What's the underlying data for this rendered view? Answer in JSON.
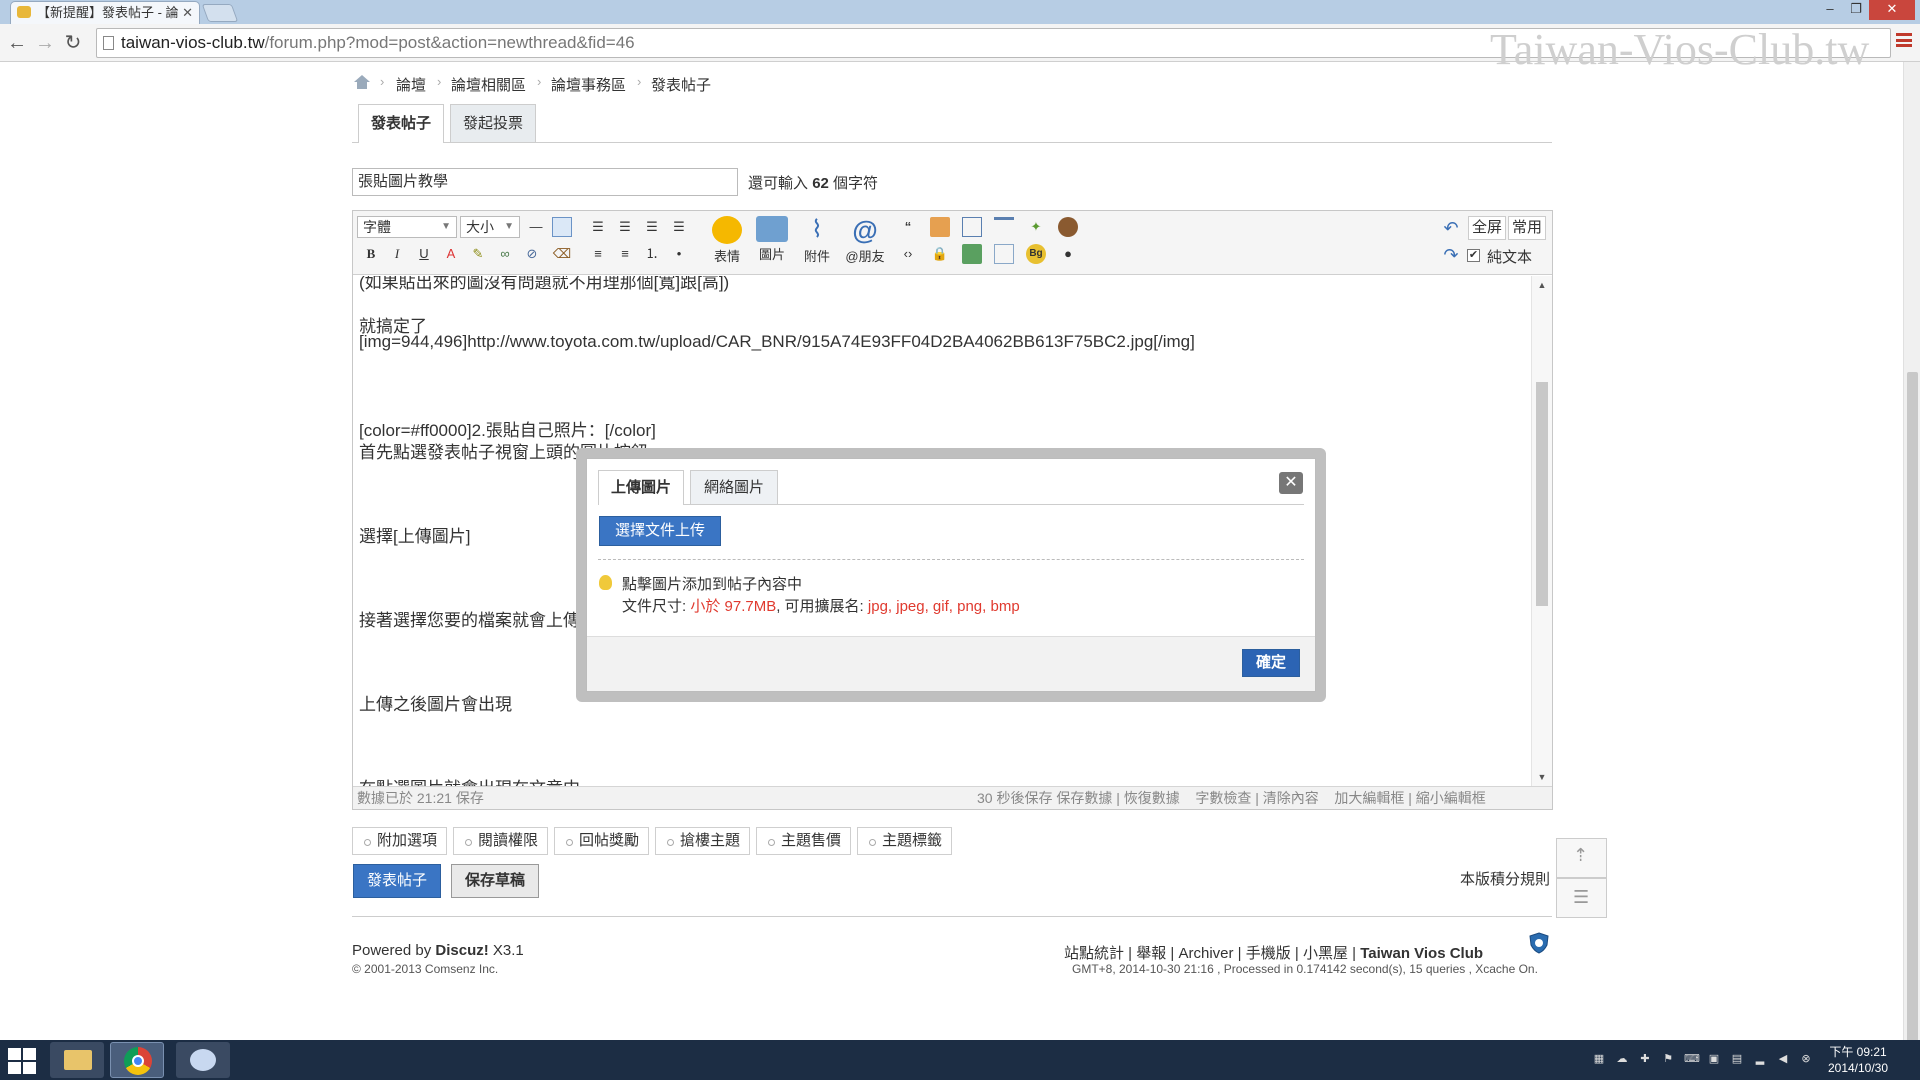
{
  "browser": {
    "tab_title": "【新提醒】發表帖子 - 論",
    "url_host": "taiwan-vios-club.tw",
    "url_path": "/forum.php?mod=post&action=newthread&fid=46",
    "watermark": "Taiwan-Vios-Club.tw"
  },
  "breadcrumb": [
    "論壇",
    "論壇相關區",
    "論壇事務區",
    "發表帖子"
  ],
  "post_tabs": [
    "發表帖子",
    "發起投票"
  ],
  "subject": {
    "value": "張貼圖片教學",
    "remain_prefix": "還可輸入",
    "remain_count": "62",
    "remain_suffix": "個字符"
  },
  "toolbar": {
    "font_label": "字體",
    "size_label": "大小",
    "emoji_label": "表情",
    "image_label": "圖片",
    "attach_label": "附件",
    "friend_label": "@朋友",
    "fullscreen_label": "全屏",
    "common_label": "常用",
    "plaintext_label": "純文本"
  },
  "editor_lines": [
    "(如果貼出來的圖沒有問題就不用理那個[寬]跟[高])",
    "就搞定了",
    "[img=944,496]http://www.toyota.com.tw/upload/CAR_BNR/915A74E93FF04D2BA4062BB613F75BC2.jpg[/img]",
    "[color=#ff0000]2.張貼自己照片：[/color]",
    "首先點選發表帖子視窗上頭的圖片按鈕",
    "選擇[上傳圖片]",
    "接著選擇您要的檔案就會上傳",
    "上傳之後圖片會出現",
    "在點選圖片就會出現在文章中"
  ],
  "editor_status": {
    "saved_text": "數據已於 21:21 保存",
    "autosave": "30 秒後保存",
    "save_data": "保存數據",
    "restore_data": "恢復數據",
    "word_check": "字數檢查",
    "clear": "清除內容",
    "enlarge": "加大編輯框",
    "shrink": "縮小編輯框"
  },
  "dialog": {
    "tabs": [
      "上傳圖片",
      "網絡圖片"
    ],
    "upload_button": "選擇文件上传",
    "hint": "點擊圖片添加到帖子內容中",
    "size_label": "文件尺寸: ",
    "size_value": "小於 97.7MB",
    "ext_label": ", 可用擴展名: ",
    "ext_value": "jpg, jpeg, gif, png, bmp",
    "confirm": "確定"
  },
  "options": [
    "附加選項",
    "閱讀權限",
    "回帖獎勵",
    "搶樓主題",
    "主題售價",
    "主題標籤"
  ],
  "actions": {
    "submit": "發表帖子",
    "draft": "保存草稿",
    "score_rules": "本版積分規則"
  },
  "footer": {
    "powered_prefix": "Powered by ",
    "powered_brand": "Discuz!",
    "powered_version": " X3.1",
    "copyright": "© 2001-2013 Comsenz Inc.",
    "links": [
      "站點統計",
      "舉報",
      "Archiver",
      "手機版",
      "小黑屋"
    ],
    "site_name": "Taiwan Vios Club",
    "stats": "GMT+8, 2014-10-30 21:16 , Processed in 0.174142 second(s), 15 queries , Xcache On."
  },
  "taskbar": {
    "time": "下午 09:21",
    "date": "2014/10/30"
  },
  "colors": {
    "accent_blue": "#3a75c4",
    "warn_red": "#e03a2f",
    "taskbar": "#1c2d44"
  }
}
